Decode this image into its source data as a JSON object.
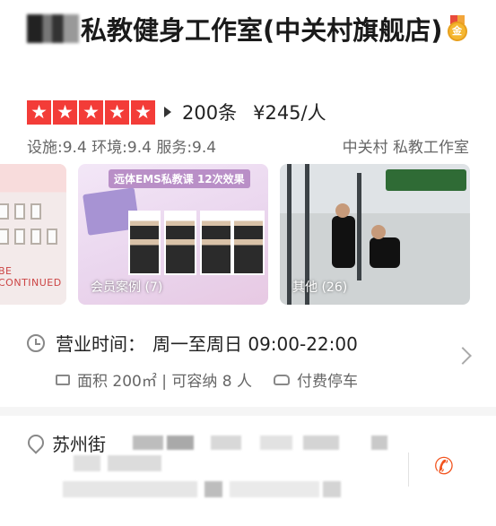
{
  "header": {
    "shop_name": "私教健身工作室(中关村旗舰店)",
    "medal_char": "金",
    "medal_icon": "gold-medal-icon"
  },
  "rating": {
    "stars": 5,
    "review_count": "200条",
    "price": "¥245/人"
  },
  "scores": {
    "text": "设施:9.4 环境:9.4 服务:9.4",
    "area_tag": "中关村 私教工作室"
  },
  "gallery": {
    "photos": [
      {
        "caption": "",
        "motto": "BE CONTINUED"
      },
      {
        "caption": "会员案例 (7)",
        "banner": "远体EMS私教课 12次效果"
      },
      {
        "caption": "其他 (26)"
      }
    ]
  },
  "info": {
    "hours_label": "营业时间：",
    "hours_value": "周一至周日 09:00-22:00",
    "area_text": "面积 200㎡ | 可容纳 8 人",
    "parking_text": "付费停车"
  },
  "address": {
    "street": "苏州街"
  },
  "colors": {
    "star_red": "#f33c38",
    "phone_orange": "#f2531d"
  }
}
